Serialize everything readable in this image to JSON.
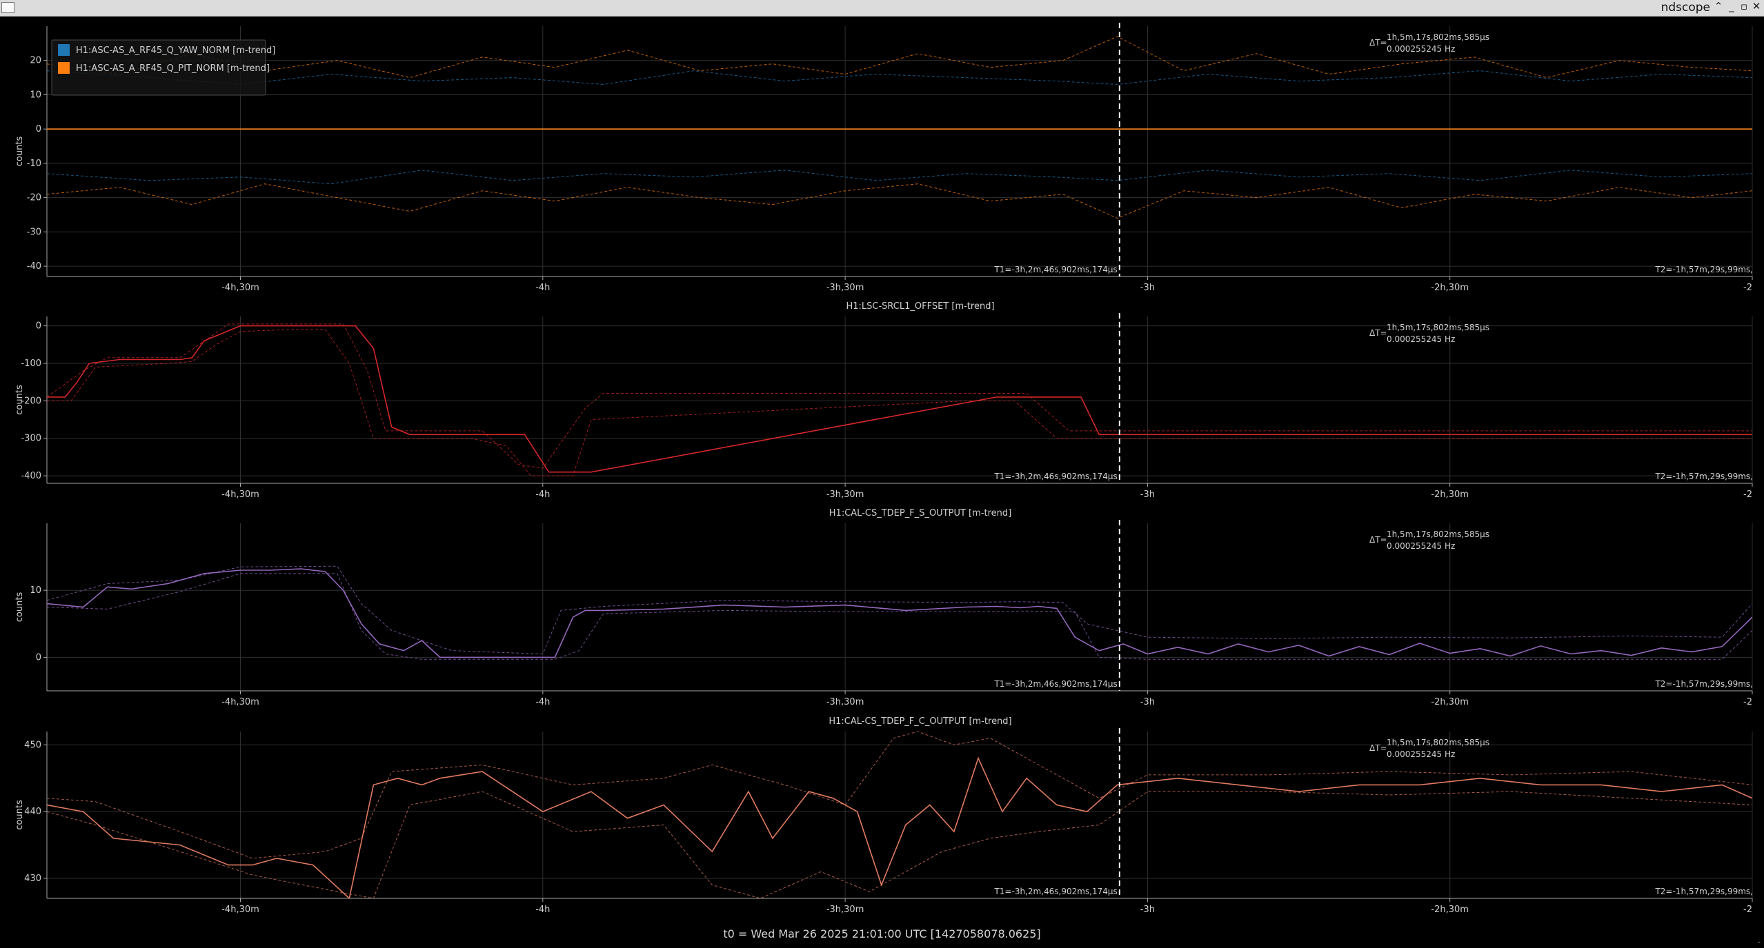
{
  "window": {
    "title": "ndscope",
    "buttons": [
      {
        "name": "collapse-icon",
        "glyph": "⌃"
      },
      {
        "name": "minimize-icon",
        "glyph": "_"
      },
      {
        "name": "maximize-icon",
        "glyph": "▫"
      },
      {
        "name": "close-icon",
        "glyph": "✕"
      }
    ]
  },
  "colors": {
    "background": "#000000",
    "grid": "#303030",
    "axis": "#a8a8a8",
    "text": "#d0d0d0",
    "cursor": "#ffffff",
    "yaw": "#1f77b4",
    "pit": "#ff7f0e",
    "srcl": "#d62728",
    "fs": "#9467bd",
    "fc": "#e07a5f"
  },
  "footer": {
    "t0": "t0 = Wed Mar 26 2025 21:01:00 UTC [1427058078.0625]",
    "corner": "-"
  },
  "cursors": {
    "t1_label": "T1=-3h,2m,46s,902ms,174µs",
    "t2_label": "T2=-1h,57m,29s,99ms,",
    "delta_prefix": "ΔT=",
    "delta_time": "1h,5m,17s,802ms,585µs",
    "delta_freq": "0.000255245 Hz"
  },
  "chart_data": [
    {
      "type": "line",
      "title": "",
      "ylabel": "counts",
      "xlim": [
        -4.82,
        -2.0
      ],
      "ylim": [
        -43,
        30
      ],
      "yticks": [
        20,
        10,
        0,
        -10,
        -20,
        -30,
        -40
      ],
      "xticks": [
        {
          "x": -4.5,
          "label": "-4h,30m"
        },
        {
          "x": -4.0,
          "label": "-4h"
        },
        {
          "x": -3.5,
          "label": "-3h,30m"
        },
        {
          "x": -3.0,
          "label": "-3h"
        },
        {
          "x": -2.5,
          "label": "-2h,30m"
        },
        {
          "x": -2.0,
          "label": "-2"
        }
      ],
      "cursor_x": -3.0463,
      "legend": {
        "placement": "top-left",
        "entries": [
          {
            "name": "H1:ASC-AS_A_RF45_Q_YAW_NORM [m-trend]",
            "color": "#1f77b4"
          },
          {
            "name": "H1:ASC-AS_A_RF45_Q_PIT_NORM [m-trend]",
            "color": "#ff7f0e"
          }
        ]
      },
      "series": [
        {
          "id": "yaw-mean",
          "color": "#1f77b4",
          "style": "solid",
          "x": [
            -4.82,
            -2.0
          ],
          "y": [
            0,
            0
          ]
        },
        {
          "id": "pit-mean",
          "color": "#ff7f0e",
          "style": "solid",
          "x": [
            -4.82,
            -2.0
          ],
          "y": [
            0,
            0
          ]
        },
        {
          "id": "yaw-max",
          "color": "#1f77b4",
          "style": "dashed",
          "x": [
            -4.82,
            -4.65,
            -4.5,
            -4.35,
            -4.2,
            -4.05,
            -3.9,
            -3.75,
            -3.6,
            -3.45,
            -3.3,
            -3.15,
            -3.05,
            -2.9,
            -2.75,
            -2.6,
            -2.45,
            -2.3,
            -2.15,
            -2.0
          ],
          "y": [
            17,
            15,
            13,
            16,
            14,
            15,
            13,
            17,
            14,
            16,
            15,
            14,
            13,
            16,
            14,
            15,
            17,
            14,
            16,
            15
          ]
        },
        {
          "id": "yaw-min",
          "color": "#1f77b4",
          "style": "dashed",
          "x": [
            -4.82,
            -4.65,
            -4.5,
            -4.35,
            -4.2,
            -4.05,
            -3.9,
            -3.75,
            -3.6,
            -3.45,
            -3.3,
            -3.15,
            -3.05,
            -2.9,
            -2.75,
            -2.6,
            -2.45,
            -2.3,
            -2.15,
            -2.0
          ],
          "y": [
            -13,
            -15,
            -14,
            -16,
            -12,
            -15,
            -13,
            -14,
            -12,
            -15,
            -13,
            -14,
            -15,
            -12,
            -14,
            -13,
            -15,
            -12,
            -14,
            -13
          ]
        },
        {
          "id": "pit-max",
          "color": "#ff7f0e",
          "style": "dashed",
          "x": [
            -4.82,
            -4.7,
            -4.58,
            -4.46,
            -4.34,
            -4.22,
            -4.1,
            -3.98,
            -3.86,
            -3.74,
            -3.62,
            -3.5,
            -3.38,
            -3.26,
            -3.14,
            -3.05,
            -2.94,
            -2.82,
            -2.7,
            -2.58,
            -2.46,
            -2.34,
            -2.22,
            -2.1,
            -2.0
          ],
          "y": [
            19,
            16,
            22,
            17,
            20,
            15,
            21,
            18,
            23,
            17,
            19,
            16,
            22,
            18,
            20,
            27,
            17,
            22,
            16,
            19,
            21,
            15,
            20,
            18,
            17
          ]
        },
        {
          "id": "pit-min",
          "color": "#ff7f0e",
          "style": "dashed",
          "x": [
            -4.82,
            -4.7,
            -4.58,
            -4.46,
            -4.34,
            -4.22,
            -4.1,
            -3.98,
            -3.86,
            -3.74,
            -3.62,
            -3.5,
            -3.38,
            -3.26,
            -3.14,
            -3.05,
            -2.94,
            -2.82,
            -2.7,
            -2.58,
            -2.46,
            -2.34,
            -2.22,
            -2.1,
            -2.0
          ],
          "y": [
            -19,
            -17,
            -22,
            -16,
            -20,
            -24,
            -18,
            -21,
            -17,
            -20,
            -22,
            -18,
            -16,
            -21,
            -19,
            -26,
            -18,
            -20,
            -17,
            -23,
            -19,
            -21,
            -17,
            -20,
            -18
          ]
        }
      ]
    },
    {
      "type": "line",
      "title": "H1:LSC-SRCL1_OFFSET [m-trend]",
      "ylabel": "counts",
      "xlim": [
        -4.82,
        -2.0
      ],
      "ylim": [
        -420,
        25
      ],
      "yticks": [
        0,
        -100,
        -200,
        -300,
        -400
      ],
      "xticks": [
        {
          "x": -4.5,
          "label": "-4h,30m"
        },
        {
          "x": -4.0,
          "label": "-4h"
        },
        {
          "x": -3.5,
          "label": "-3h,30m"
        },
        {
          "x": -3.0,
          "label": "-3h"
        },
        {
          "x": -2.5,
          "label": "-2h,30m"
        },
        {
          "x": -2.0,
          "label": "-2"
        }
      ],
      "cursor_x": -3.0463,
      "series": [
        {
          "id": "srcl-mean",
          "color": "#d62728",
          "style": "solid",
          "x": [
            -4.82,
            -4.79,
            -4.77,
            -4.75,
            -4.7,
            -4.67,
            -4.65,
            -4.6,
            -4.58,
            -4.56,
            -4.53,
            -4.5,
            -4.46,
            -4.42,
            -4.36,
            -4.31,
            -4.28,
            -4.25,
            -4.22,
            -4.18,
            -4.1,
            -4.03,
            -3.99,
            -3.95,
            -3.92,
            -3.25,
            -3.11,
            -3.08,
            -2.0
          ],
          "y": [
            -190,
            -190,
            -150,
            -100,
            -90,
            -90,
            -90,
            -90,
            -85,
            -40,
            -20,
            0,
            0,
            0,
            0,
            0,
            -60,
            -270,
            -290,
            -290,
            -290,
            -290,
            -390,
            -390,
            -390,
            -190,
            -190,
            -290,
            -290
          ]
        },
        {
          "id": "srcl-max",
          "color": "#d62728",
          "style": "dashed",
          "x": [
            -4.82,
            -4.76,
            -4.72,
            -4.6,
            -4.55,
            -4.52,
            -4.48,
            -4.4,
            -4.33,
            -4.29,
            -4.26,
            -4.1,
            -4.04,
            -4.0,
            -3.93,
            -3.9,
            -3.3,
            -3.2,
            -3.13,
            -2.0
          ],
          "y": [
            -190,
            -120,
            -85,
            -85,
            -30,
            5,
            5,
            5,
            5,
            -120,
            -280,
            -280,
            -370,
            -380,
            -220,
            -180,
            -180,
            -180,
            -280,
            -280
          ]
        },
        {
          "id": "srcl-min",
          "color": "#d62728",
          "style": "dashed",
          "x": [
            -4.82,
            -4.78,
            -4.74,
            -4.62,
            -4.58,
            -4.54,
            -4.5,
            -4.42,
            -4.36,
            -4.32,
            -4.28,
            -4.12,
            -4.06,
            -4.02,
            -3.95,
            -3.92,
            -3.3,
            -3.22,
            -3.15,
            -2.0
          ],
          "y": [
            -200,
            -200,
            -110,
            -100,
            -95,
            -50,
            -15,
            -10,
            -10,
            -100,
            -300,
            -300,
            -320,
            -400,
            -400,
            -250,
            -200,
            -200,
            -300,
            -300
          ]
        }
      ]
    },
    {
      "type": "line",
      "title": "H1:CAL-CS_TDEP_F_S_OUTPUT [m-trend]",
      "ylabel": "counts",
      "xlim": [
        -4.82,
        -2.0
      ],
      "ylim": [
        -5,
        20
      ],
      "yticks": [
        10,
        0
      ],
      "xticks": [
        {
          "x": -4.5,
          "label": "-4h,30m"
        },
        {
          "x": -4.0,
          "label": "-4h"
        },
        {
          "x": -3.5,
          "label": "-3h,30m"
        },
        {
          "x": -3.0,
          "label": "-3h"
        },
        {
          "x": -2.5,
          "label": "-2h,30m"
        },
        {
          "x": -2.0,
          "label": "-2"
        }
      ],
      "cursor_x": -3.0463,
      "series": [
        {
          "id": "fs-mean",
          "color": "#9467bd",
          "style": "solid",
          "x": [
            -4.82,
            -4.76,
            -4.72,
            -4.68,
            -4.62,
            -4.56,
            -4.5,
            -4.45,
            -4.4,
            -4.36,
            -4.33,
            -4.3,
            -4.27,
            -4.23,
            -4.2,
            -4.17,
            -4.14,
            -4.1,
            -4.05,
            -4.01,
            -3.98,
            -3.95,
            -3.93,
            -3.9,
            -3.8,
            -3.7,
            -3.6,
            -3.5,
            -3.4,
            -3.3,
            -3.25,
            -3.21,
            -3.18,
            -3.15,
            -3.12,
            -3.08,
            -3.04,
            -3.0,
            -2.95,
            -2.9,
            -2.85,
            -2.8,
            -2.75,
            -2.7,
            -2.65,
            -2.6,
            -2.55,
            -2.5,
            -2.45,
            -2.4,
            -2.35,
            -2.3,
            -2.25,
            -2.2,
            -2.15,
            -2.1,
            -2.05,
            -2.0
          ],
          "y": [
            8,
            7.5,
            10.5,
            10.2,
            11,
            12.5,
            13,
            13,
            13.2,
            12.8,
            10,
            5,
            2,
            1,
            2.5,
            0,
            0,
            0,
            0,
            0,
            0,
            6,
            7,
            7,
            7.2,
            7.8,
            7.5,
            7.8,
            7.0,
            7.5,
            7.6,
            7.4,
            7.6,
            7.3,
            3,
            1,
            2,
            0.5,
            1.5,
            0.5,
            2,
            0.8,
            1.8,
            0.2,
            1.6,
            0.4,
            2.1,
            0.6,
            1.3,
            0.2,
            1.7,
            0.5,
            1.0,
            0.3,
            1.4,
            0.8,
            1.6,
            6
          ]
        },
        {
          "id": "fs-max",
          "color": "#9467bd",
          "style": "dashed",
          "x": [
            -4.82,
            -4.72,
            -4.6,
            -4.5,
            -4.34,
            -4.3,
            -4.25,
            -4.15,
            -4.0,
            -3.97,
            -3.9,
            -3.7,
            -3.5,
            -3.3,
            -3.22,
            -3.14,
            -3.1,
            -3.0,
            -2.8,
            -2.6,
            -2.4,
            -2.2,
            -2.05,
            -2.0
          ],
          "y": [
            8.5,
            11,
            11.5,
            13.5,
            13.6,
            8,
            4,
            1,
            0.5,
            7,
            7.6,
            8.5,
            8.3,
            8.2,
            8.3,
            8.2,
            5,
            3,
            2.8,
            3,
            2.9,
            3.2,
            3,
            8
          ]
        },
        {
          "id": "fs-min",
          "color": "#9467bd",
          "style": "dashed",
          "x": [
            -4.82,
            -4.72,
            -4.6,
            -4.5,
            -4.34,
            -4.3,
            -4.26,
            -4.2,
            -3.98,
            -3.94,
            -3.9,
            -3.7,
            -3.5,
            -3.3,
            -3.2,
            -3.12,
            -3.08,
            -3.0,
            -2.8,
            -2.6,
            -2.4,
            -2.2,
            -2.05,
            -2.0
          ],
          "y": [
            7.5,
            7.2,
            9.8,
            12.5,
            12.5,
            4,
            0.5,
            -0.3,
            -0.3,
            1,
            6.5,
            7,
            6.8,
            6.8,
            6.9,
            6.8,
            0,
            -0.3,
            -0.3,
            -0.3,
            -0.3,
            -0.3,
            -0.3,
            4
          ]
        }
      ]
    },
    {
      "type": "line",
      "title": "H1:CAL-CS_TDEP_F_C_OUTPUT [m-trend]",
      "ylabel": "counts",
      "xlim": [
        -4.82,
        -2.0
      ],
      "ylim": [
        427,
        452
      ],
      "yticks": [
        450,
        440,
        430
      ],
      "xticks": [
        {
          "x": -4.5,
          "label": "-4h,30m"
        },
        {
          "x": -4.0,
          "label": "-4h"
        },
        {
          "x": -3.5,
          "label": "-3h,30m"
        },
        {
          "x": -3.0,
          "label": "-3h"
        },
        {
          "x": -2.5,
          "label": "-2h,30m"
        },
        {
          "x": -2.0,
          "label": "-2"
        }
      ],
      "cursor_x": -3.0463,
      "series": [
        {
          "id": "fc-mean",
          "color": "#e07a5f",
          "style": "solid",
          "x": [
            -4.82,
            -4.76,
            -4.71,
            -4.6,
            -4.52,
            -4.48,
            -4.44,
            -4.38,
            -4.32,
            -4.28,
            -4.24,
            -4.2,
            -4.17,
            -4.1,
            -4.0,
            -3.92,
            -3.86,
            -3.8,
            -3.72,
            -3.66,
            -3.62,
            -3.56,
            -3.52,
            -3.48,
            -3.44,
            -3.4,
            -3.36,
            -3.32,
            -3.28,
            -3.24,
            -3.2,
            -3.15,
            -3.1,
            -3.05,
            -2.95,
            -2.85,
            -2.75,
            -2.65,
            -2.55,
            -2.45,
            -2.35,
            -2.25,
            -2.15,
            -2.05,
            -2.0
          ],
          "y": [
            441,
            440,
            436,
            435,
            432,
            432,
            433,
            432,
            427,
            444,
            445,
            444,
            445,
            446,
            440,
            443,
            439,
            441,
            434,
            443,
            436,
            443,
            442,
            440,
            429,
            438,
            441,
            437,
            448,
            440,
            445,
            441,
            440,
            444,
            445,
            444,
            443,
            444,
            444,
            445,
            444,
            444,
            443,
            444,
            442
          ]
        },
        {
          "id": "fc-max",
          "color": "#e07a5f",
          "style": "dashed",
          "x": [
            -4.82,
            -4.74,
            -4.6,
            -4.48,
            -4.36,
            -4.3,
            -4.25,
            -4.1,
            -3.95,
            -3.8,
            -3.72,
            -3.6,
            -3.5,
            -3.42,
            -3.38,
            -3.32,
            -3.26,
            -3.18,
            -3.08,
            -3.0,
            -2.8,
            -2.6,
            -2.4,
            -2.2,
            -2.0
          ],
          "y": [
            442,
            441.5,
            437,
            433,
            434,
            436,
            446,
            447,
            444,
            445,
            447,
            444,
            441,
            451,
            452,
            450,
            451,
            447,
            442,
            445.5,
            445.5,
            446,
            445.5,
            446,
            444
          ]
        },
        {
          "id": "fc-min",
          "color": "#e07a5f",
          "style": "dashed",
          "x": [
            -4.82,
            -4.74,
            -4.6,
            -4.48,
            -4.34,
            -4.28,
            -4.22,
            -4.1,
            -3.95,
            -3.8,
            -3.72,
            -3.64,
            -3.54,
            -3.46,
            -3.4,
            -3.34,
            -3.26,
            -3.18,
            -3.08,
            -3.0,
            -2.8,
            -2.6,
            -2.4,
            -2.2,
            -2.0
          ],
          "y": [
            440,
            438,
            434,
            430.5,
            428,
            427,
            441,
            443,
            437,
            438,
            429,
            427,
            431,
            428,
            431,
            434,
            436,
            437,
            438,
            443,
            443,
            442.5,
            443,
            442,
            441
          ]
        }
      ]
    }
  ]
}
